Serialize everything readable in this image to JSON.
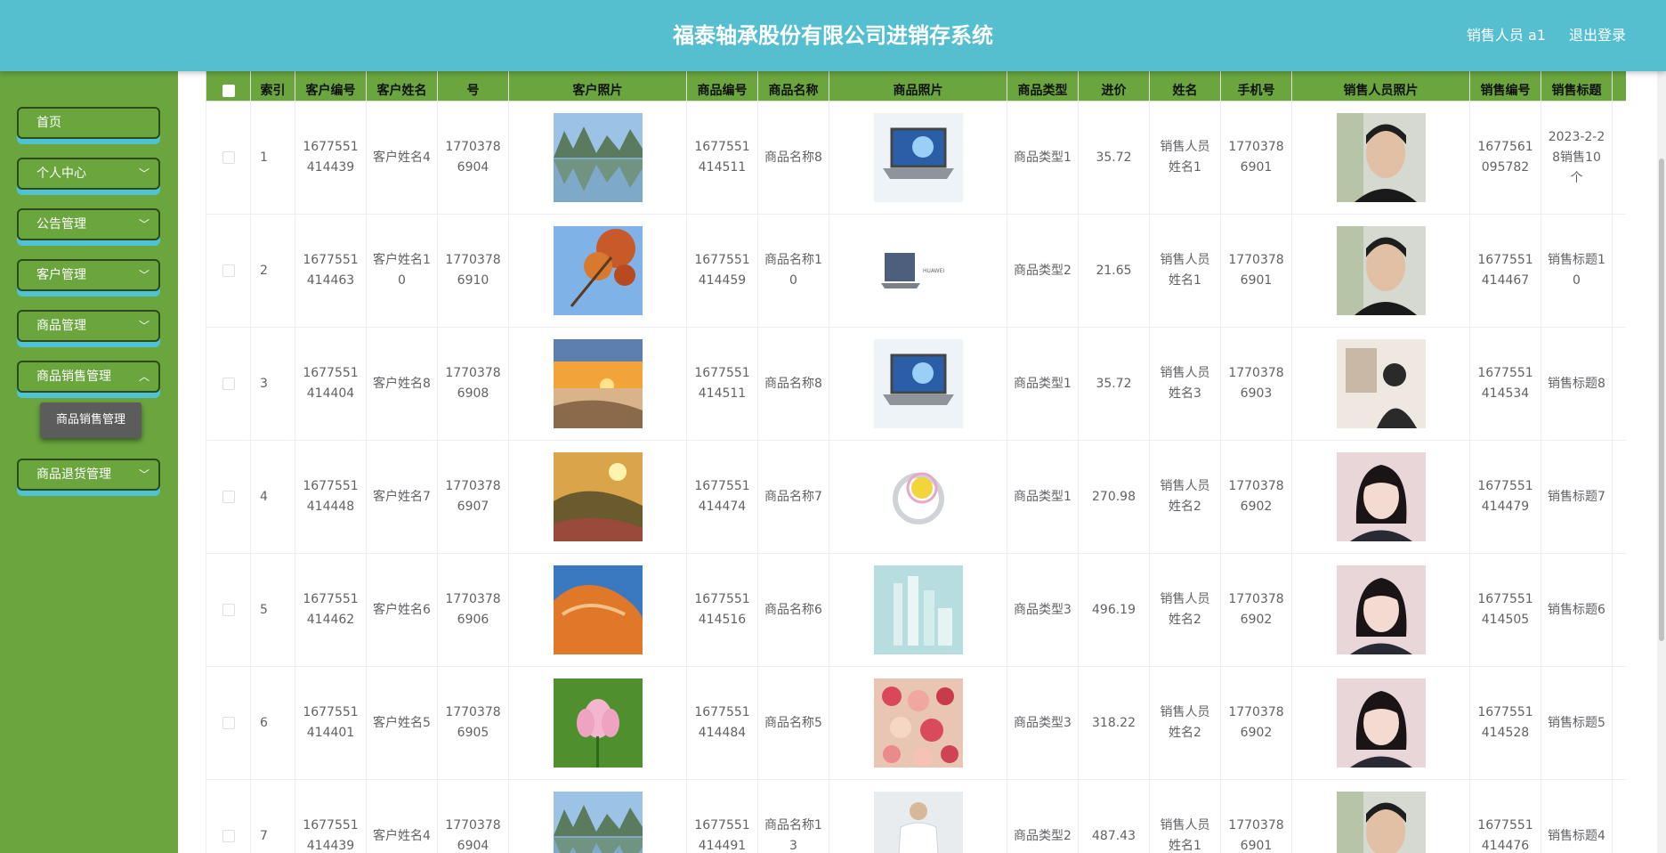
{
  "header": {
    "title": "福泰轴承股份有限公司进销存系统",
    "user": "销售人员 a1",
    "logout": "退出登录"
  },
  "sidebar": {
    "items": [
      {
        "label": "首页",
        "chevron": false
      },
      {
        "label": "个人中心",
        "chevron": true
      },
      {
        "label": "公告管理",
        "chevron": true
      },
      {
        "label": "客户管理",
        "chevron": true
      },
      {
        "label": "商品管理",
        "chevron": true
      },
      {
        "label": "商品销售管理",
        "chevron": true
      },
      {
        "label": "商品退货管理",
        "chevron": true
      }
    ],
    "active_submenu": "商品销售管理"
  },
  "table": {
    "headers": {
      "index": "索引",
      "customer_no": "客户编号",
      "customer_name": "客户姓名",
      "customer_phone": "号",
      "customer_photo": "客户照片",
      "product_no": "商品编号",
      "product_name": "商品名称",
      "product_photo": "商品照片",
      "product_type": "商品类型",
      "price": "进价",
      "sales_name": "姓名",
      "sales_phone": "手机号",
      "sales_photo": "销售人员照片",
      "sale_no": "销售编号",
      "sale_title": "销售标题"
    },
    "rows": [
      {
        "index": "1",
        "customer_no": "1677551414439",
        "customer_name": "客户姓名4",
        "customer_phone": "17703786904",
        "customer_photo": "lake-mountains",
        "product_no": "1677551414511",
        "product_name": "商品名称8",
        "product_photo": "laptop-blue",
        "product_type": "商品类型1",
        "price": "35.72",
        "sales_name": "销售人员姓名1",
        "sales_phone": "17703786901",
        "sales_photo": "man-portrait",
        "sale_no": "1677561095782",
        "sale_title": "2023-2-28销售10个"
      },
      {
        "index": "2",
        "customer_no": "1677551414463",
        "customer_name": "客户姓名10",
        "customer_phone": "17703786910",
        "customer_photo": "autumn-leaves",
        "product_no": "1677551414459",
        "product_name": "商品名称10",
        "product_photo": "laptop-grey",
        "product_type": "商品类型2",
        "price": "21.65",
        "sales_name": "销售人员姓名1",
        "sales_phone": "17703786901",
        "sales_photo": "man-portrait",
        "sale_no": "1677551414467",
        "sale_title": "销售标题10"
      },
      {
        "index": "3",
        "customer_no": "1677551414404",
        "customer_name": "客户姓名8",
        "customer_phone": "17703786908",
        "customer_photo": "sunset-beach",
        "product_no": "1677551414511",
        "product_name": "商品名称8",
        "product_photo": "laptop-blue",
        "product_type": "商品类型1",
        "price": "35.72",
        "sales_name": "销售人员姓名3",
        "sales_phone": "17703786903",
        "sales_photo": "man-back",
        "sale_no": "1677551414534",
        "sale_title": "销售标题8"
      },
      {
        "index": "4",
        "customer_no": "1677551414448",
        "customer_name": "客户姓名7",
        "customer_phone": "17703786907",
        "customer_photo": "hill-sunset",
        "product_no": "1677551414474",
        "product_name": "商品名称7",
        "product_photo": "ring",
        "product_type": "商品类型1",
        "price": "270.98",
        "sales_name": "销售人员姓名2",
        "sales_phone": "17703786902",
        "sales_photo": "woman-portrait",
        "sale_no": "1677551414479",
        "sale_title": "销售标题7"
      },
      {
        "index": "5",
        "customer_no": "1677551414462",
        "customer_name": "客户姓名6",
        "customer_phone": "17703786906",
        "customer_photo": "orange-rock",
        "product_no": "1677551414516",
        "product_name": "商品名称6",
        "product_photo": "cosmetics",
        "product_type": "商品类型3",
        "price": "496.19",
        "sales_name": "销售人员姓名2",
        "sales_phone": "17703786902",
        "sales_photo": "woman-portrait",
        "sale_no": "1677551414505",
        "sale_title": "销售标题6"
      },
      {
        "index": "6",
        "customer_no": "1677551414401",
        "customer_name": "客户姓名5",
        "customer_phone": "17703786905",
        "customer_photo": "lotus",
        "product_no": "1677551414484",
        "product_name": "商品名称5",
        "product_photo": "roses",
        "product_type": "商品类型3",
        "price": "318.22",
        "sales_name": "销售人员姓名2",
        "sales_phone": "17703786902",
        "sales_photo": "woman-portrait",
        "sale_no": "1677551414528",
        "sale_title": "销售标题5"
      },
      {
        "index": "7",
        "customer_no": "1677551414439",
        "customer_name": "客户姓名4",
        "customer_phone": "17703786904",
        "customer_photo": "lake-mountains",
        "product_no": "1677551414491",
        "product_name": "商品名称13",
        "product_photo": "white-shirt",
        "product_type": "商品类型2",
        "price": "487.43",
        "sales_name": "销售人员姓名1",
        "sales_phone": "17703786901",
        "sales_photo": "man-portrait",
        "sale_no": "1677551414476",
        "sale_title": "销售标题4"
      }
    ]
  },
  "colors": {
    "header": "#55bfcf",
    "sidebar": "#6aa53e",
    "table_header": "#6aa53e",
    "menu_shadow": "#4fc3d3"
  }
}
